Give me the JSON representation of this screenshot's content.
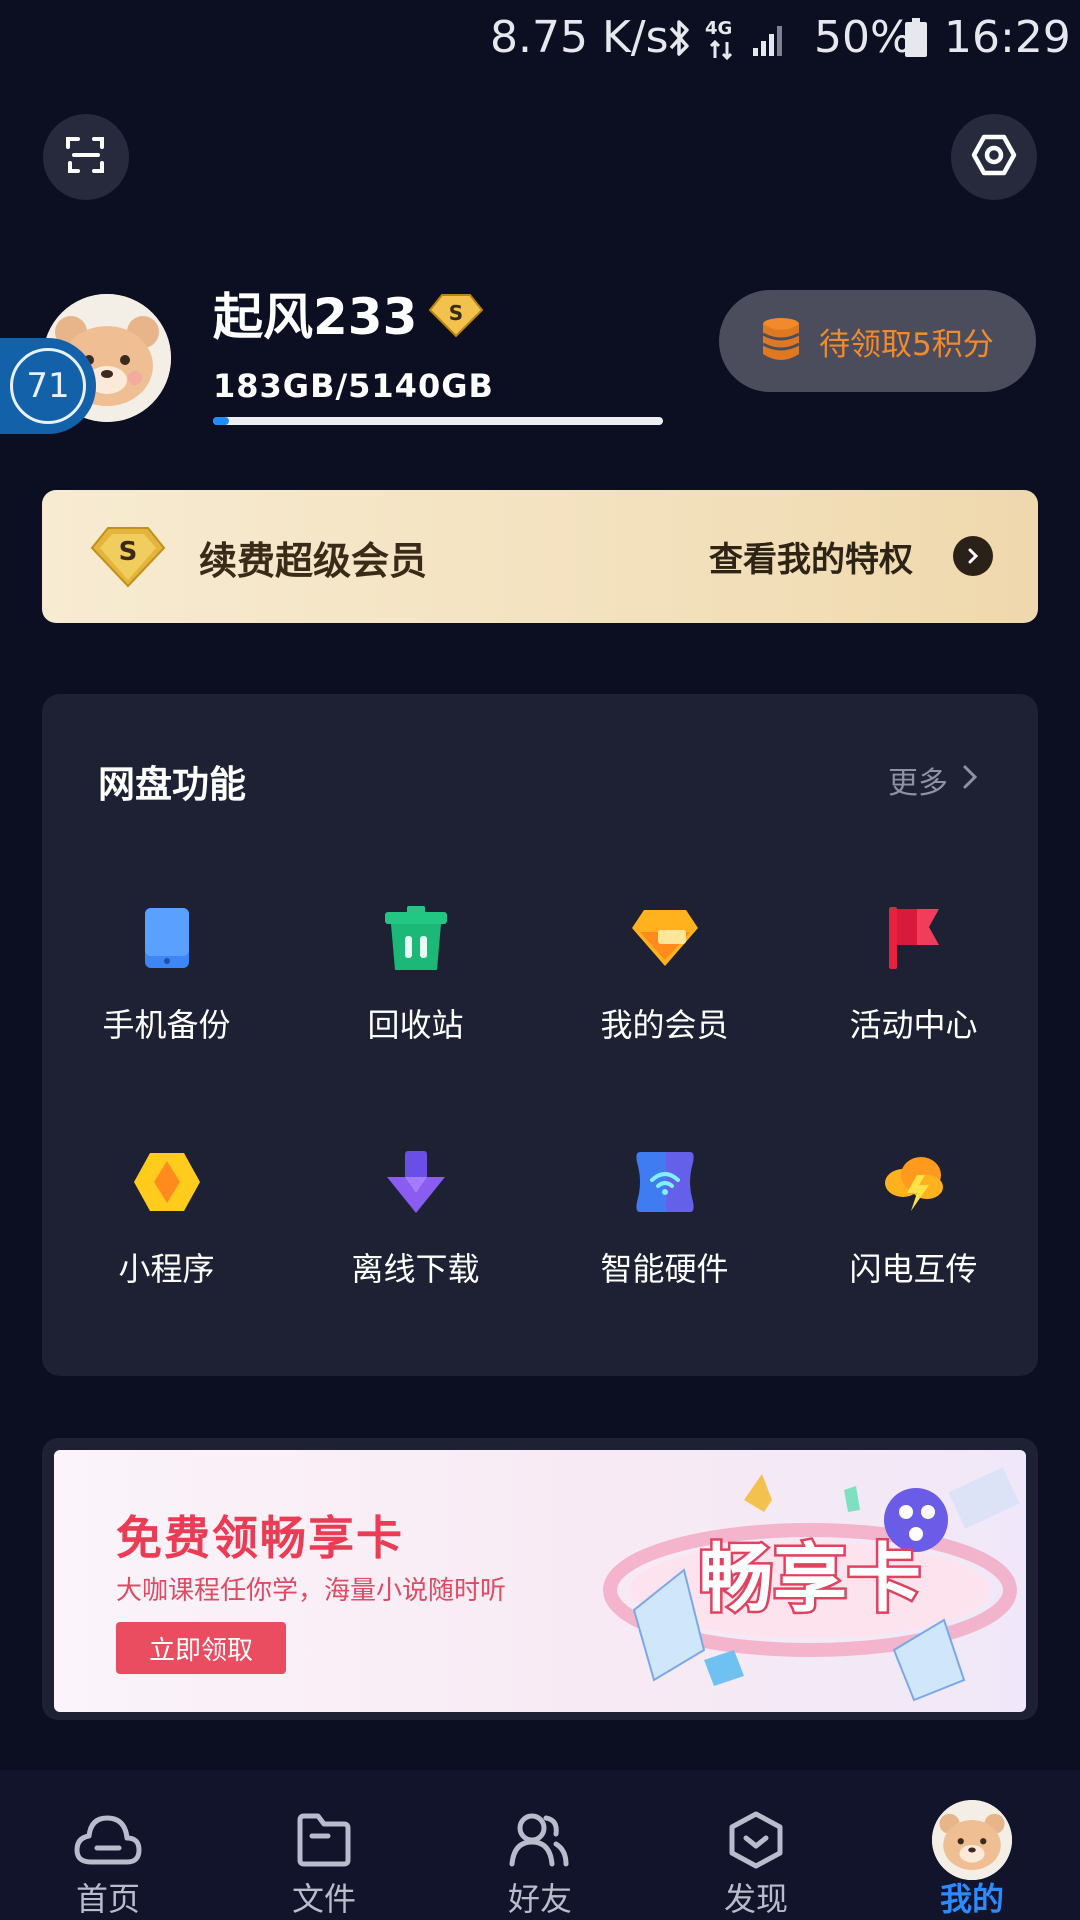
{
  "status_bar": {
    "net_speed": "8.75 K/s",
    "network": "4G",
    "battery": "50%",
    "time": "16:29",
    "icons": [
      "bluetooth-icon",
      "signal-icon",
      "battery-icon"
    ]
  },
  "header": {
    "scan_icon": "scan-icon",
    "settings_icon": "settings-icon"
  },
  "profile": {
    "username": "起风233",
    "level": "71",
    "vip_badge": "S",
    "storage_text": "183GB/5140GB",
    "storage_used_fraction": 0.036,
    "points_label": "待领取5积分"
  },
  "vip_banner": {
    "badge": "S",
    "title": "续费超级会员",
    "link": "查看我的特权"
  },
  "features": {
    "title": "网盘功能",
    "more": "更多",
    "items": [
      {
        "label": "手机备份",
        "icon": "phone-backup-icon"
      },
      {
        "label": "回收站",
        "icon": "trash-icon"
      },
      {
        "label": "我的会员",
        "icon": "diamond-icon"
      },
      {
        "label": "活动中心",
        "icon": "flag-icon"
      },
      {
        "label": "小程序",
        "icon": "mini-program-icon"
      },
      {
        "label": "离线下载",
        "icon": "download-icon"
      },
      {
        "label": "智能硬件",
        "icon": "smart-hardware-icon"
      },
      {
        "label": "闪电互传",
        "icon": "lightning-transfer-icon"
      }
    ]
  },
  "promo": {
    "title": "免费领畅享卡",
    "subtitle": "大咖课程任你学，海量小说随时听",
    "button": "立即领取",
    "art_text": "畅享卡"
  },
  "bottom_nav": {
    "items": [
      {
        "label": "首页",
        "icon": "cloud-icon"
      },
      {
        "label": "文件",
        "icon": "folder-icon"
      },
      {
        "label": "好友",
        "icon": "friends-icon"
      },
      {
        "label": "发现",
        "icon": "discover-icon"
      },
      {
        "label": "我的",
        "icon": "avatar-icon",
        "active": true
      }
    ]
  },
  "colors": {
    "background": "#0c0f22",
    "panel": "#1e2133",
    "accent": "#2a8cff",
    "points": "#f08a2b",
    "promo_red": "#ea3c55"
  }
}
